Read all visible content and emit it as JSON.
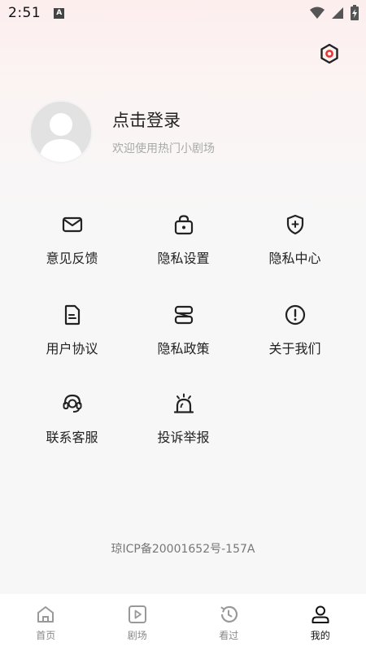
{
  "status": {
    "time": "2:51",
    "notification": "A"
  },
  "profile": {
    "title": "点击登录",
    "subtitle": "欢迎使用热门小剧场"
  },
  "menu": [
    {
      "label": "意见反馈",
      "icon": "mail-icon"
    },
    {
      "label": "隐私设置",
      "icon": "lock-icon"
    },
    {
      "label": "隐私中心",
      "icon": "shield-icon"
    },
    {
      "label": "用户协议",
      "icon": "document-icon"
    },
    {
      "label": "隐私政策",
      "icon": "policy-icon"
    },
    {
      "label": "关于我们",
      "icon": "info-icon"
    },
    {
      "label": "联系客服",
      "icon": "headset-icon"
    },
    {
      "label": "投诉举报",
      "icon": "alarm-icon"
    }
  ],
  "footer": {
    "icp": "琼ICP备20001652号-157A"
  },
  "tabs": [
    {
      "label": "首页",
      "icon": "home-icon",
      "active": false
    },
    {
      "label": "剧场",
      "icon": "play-icon",
      "active": false
    },
    {
      "label": "看过",
      "icon": "history-icon",
      "active": false
    },
    {
      "label": "我的",
      "icon": "user-icon",
      "active": true
    }
  ],
  "colors": {
    "accent": "#e53935",
    "text": "#222222",
    "muted": "#a9a9a9"
  }
}
